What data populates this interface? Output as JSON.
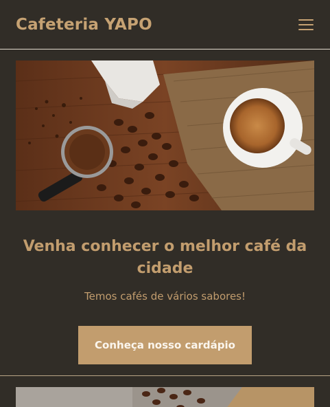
{
  "header": {
    "brand": "Cafeteria YAPO",
    "menu_icon": "hamburger-menu-icon"
  },
  "hero": {
    "image": "coffee-beans-espresso-photo",
    "headline": "Venha conhecer o melhor café da cidade",
    "subtitle": "Temos cafés de vários sabores!",
    "cta_label": "Conheça nosso cardápio"
  },
  "next_section": {
    "image": "coffee-beans-burlap-photo"
  },
  "colors": {
    "background": "#312d27",
    "accent": "#c29d6e",
    "button_text": "#fbf6ee"
  }
}
